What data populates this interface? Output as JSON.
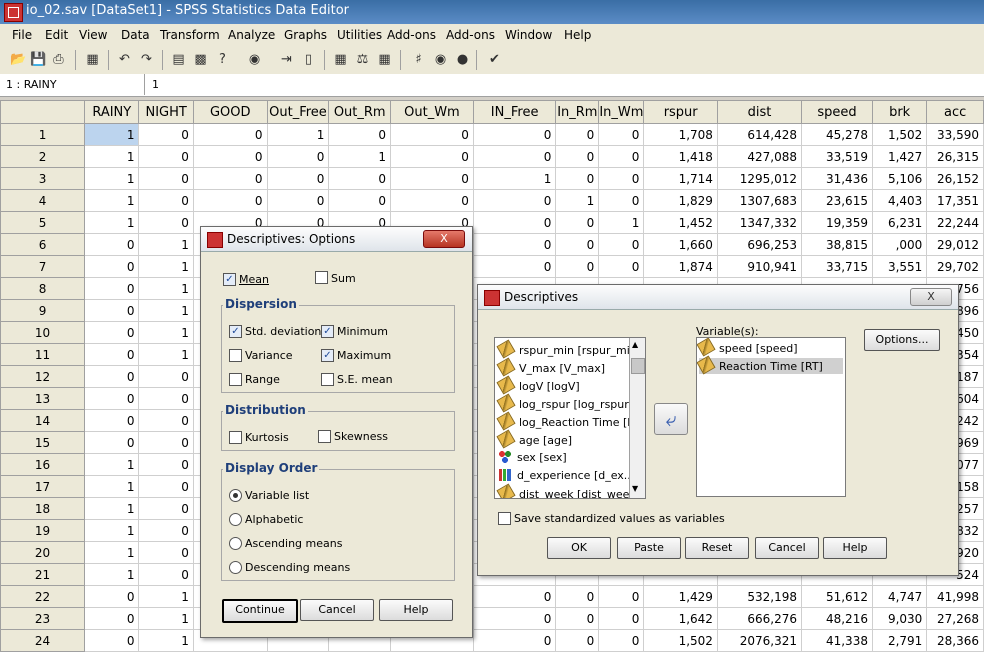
{
  "window": {
    "title": "io_02.sav [DataSet1] - SPSS Statistics Data Editor"
  },
  "menu": [
    "File",
    "Edit",
    "View",
    "Data",
    "Transform",
    "Analyze",
    "Graphs",
    "Utilities",
    "Add-ons",
    "Add-ons",
    "Window",
    "Help"
  ],
  "cellref": {
    "name": "1 : RAINY",
    "value": "1"
  },
  "grid": {
    "columns": [
      "RAINY",
      "NIGHT",
      "GOOD",
      "Out_Free",
      "Out_Rm",
      "Out_Wm",
      "IN_Free",
      "In_Rm",
      "In_Wm",
      "rspur",
      "dist",
      "speed",
      "brk",
      "acc"
    ],
    "rows": [
      [
        "1",
        "1",
        "0",
        "0",
        "1",
        "0",
        "0",
        "0",
        "0",
        "0",
        "1,708",
        "614,428",
        "45,278",
        "1,502",
        "33,590"
      ],
      [
        "2",
        "1",
        "0",
        "0",
        "0",
        "1",
        "0",
        "0",
        "0",
        "0",
        "1,418",
        "427,088",
        "33,519",
        "1,427",
        "26,315"
      ],
      [
        "3",
        "1",
        "0",
        "0",
        "0",
        "0",
        "0",
        "1",
        "0",
        "0",
        "1,714",
        "1295,012",
        "31,436",
        "5,106",
        "26,152"
      ],
      [
        "4",
        "1",
        "0",
        "0",
        "0",
        "0",
        "0",
        "0",
        "1",
        "0",
        "1,829",
        "1307,683",
        "23,615",
        "4,403",
        "17,351"
      ],
      [
        "5",
        "1",
        "0",
        "0",
        "0",
        "0",
        "0",
        "0",
        "0",
        "1",
        "1,452",
        "1347,332",
        "19,359",
        "6,231",
        "22,244"
      ],
      [
        "6",
        "0",
        "1",
        "",
        "",
        "",
        "",
        "0",
        "0",
        "0",
        "1,660",
        "696,253",
        "38,815",
        ",000",
        "29,012"
      ],
      [
        "7",
        "0",
        "1",
        "",
        "",
        "",
        "",
        "0",
        "0",
        "0",
        "1,874",
        "910,941",
        "33,715",
        "3,551",
        "29,702"
      ],
      [
        "8",
        "0",
        "1",
        "",
        "",
        "",
        "",
        "",
        "",
        "",
        "",
        "",
        "",
        "",
        "756"
      ],
      [
        "9",
        "0",
        "1",
        "",
        "",
        "",
        "",
        "",
        "",
        "",
        "",
        "",
        "",
        "",
        "896"
      ],
      [
        "10",
        "0",
        "1",
        "",
        "",
        "",
        "",
        "",
        "",
        "",
        "",
        "",
        "",
        "",
        "450"
      ],
      [
        "11",
        "0",
        "1",
        "",
        "",
        "",
        "",
        "",
        "",
        "",
        "",
        "",
        "",
        "",
        "354"
      ],
      [
        "12",
        "0",
        "0",
        "",
        "",
        "",
        "",
        "",
        "",
        "",
        "",
        "",
        "",
        "",
        "187"
      ],
      [
        "13",
        "0",
        "0",
        "",
        "",
        "",
        "",
        "",
        "",
        "",
        "",
        "",
        "",
        "",
        "604"
      ],
      [
        "14",
        "0",
        "0",
        "",
        "",
        "",
        "",
        "",
        "",
        "",
        "",
        "",
        "",
        "",
        "242"
      ],
      [
        "15",
        "0",
        "0",
        "",
        "",
        "",
        "",
        "",
        "",
        "",
        "",
        "",
        "",
        "",
        "969"
      ],
      [
        "16",
        "1",
        "0",
        "",
        "",
        "",
        "",
        "",
        "",
        "",
        "",
        "",
        "",
        "",
        "077"
      ],
      [
        "17",
        "1",
        "0",
        "",
        "",
        "",
        "",
        "",
        "",
        "",
        "",
        "",
        "",
        "",
        "158"
      ],
      [
        "18",
        "1",
        "0",
        "",
        "",
        "",
        "",
        "",
        "",
        "",
        "",
        "",
        "",
        "",
        "257"
      ],
      [
        "19",
        "1",
        "0",
        "",
        "",
        "",
        "",
        "",
        "",
        "",
        "",
        "",
        "",
        "",
        "832"
      ],
      [
        "20",
        "1",
        "0",
        "",
        "",
        "",
        "",
        "",
        "",
        "",
        "",
        "",
        "",
        "",
        "920"
      ],
      [
        "21",
        "1",
        "0",
        "",
        "",
        "",
        "",
        "",
        "",
        "",
        "",
        "",
        "",
        "",
        "524"
      ],
      [
        "22",
        "0",
        "1",
        "",
        "",
        "",
        "",
        "0",
        "0",
        "0",
        "1,429",
        "532,198",
        "51,612",
        "4,747",
        "41,998"
      ],
      [
        "23",
        "0",
        "1",
        "",
        "",
        "",
        "",
        "0",
        "0",
        "0",
        "1,642",
        "666,276",
        "48,216",
        "9,030",
        "27,268"
      ],
      [
        "24",
        "0",
        "1",
        "",
        "",
        "",
        "",
        "0",
        "0",
        "0",
        "1,502",
        "2076,321",
        "41,338",
        "2,791",
        "28,366"
      ]
    ]
  },
  "options_dialog": {
    "title": "Descriptives: Options",
    "close": "X",
    "mean": "Mean",
    "sum": "Sum",
    "dispersion_title": "Dispersion",
    "std_dev": "Std. deviation",
    "minimum": "Minimum",
    "variance": "Variance",
    "maximum": "Maximum",
    "range": "Range",
    "se_mean": "S.E. mean",
    "distribution_title": "Distribution",
    "kurtosis": "Kurtosis",
    "skewness": "Skewness",
    "display_order_title": "Display Order",
    "order_variable_list": "Variable list",
    "order_alphabetic": "Alphabetic",
    "order_ascending": "Ascending means",
    "order_descending": "Descending means",
    "continue": "Continue",
    "cancel": "Cancel",
    "help": "Help"
  },
  "desc_dialog": {
    "title": "Descriptives",
    "close": "X",
    "source_vars": [
      {
        "label": "rspur_min [rspur_min]",
        "icon": "scale-icon"
      },
      {
        "label": "V_max [V_max]",
        "icon": "scale-icon"
      },
      {
        "label": "logV [logV]",
        "icon": "scale-icon"
      },
      {
        "label": "log_rspur [log_rspur]",
        "icon": "scale-icon"
      },
      {
        "label": "log_Reaction Time [l...",
        "icon": "scale-icon"
      },
      {
        "label": "age [age]",
        "icon": "scale-icon"
      },
      {
        "label": "sex [sex]",
        "icon": "nominal-icon"
      },
      {
        "label": "d_experience [d_ex...",
        "icon": "ordinal-icon"
      },
      {
        "label": "dist_week [dist_week]",
        "icon": "scale-icon"
      }
    ],
    "variables_label": "Variable(s):",
    "selected_vars": [
      "speed [speed]",
      "Reaction Time [RT]"
    ],
    "options_button": "Options...",
    "save_std": "Save standardized values as variables",
    "ok": "OK",
    "paste": "Paste",
    "reset": "Reset",
    "cancel": "Cancel",
    "help": "Help"
  }
}
